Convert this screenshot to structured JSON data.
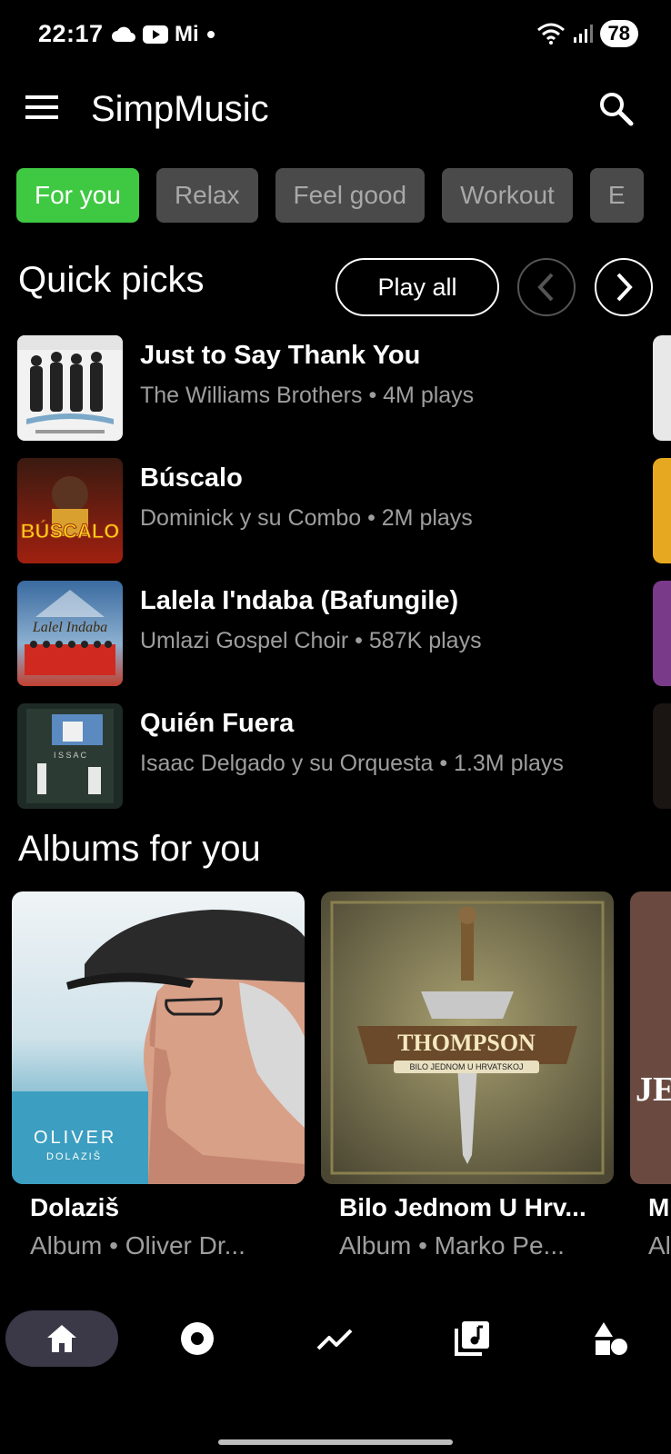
{
  "status_bar": {
    "time": "22:17",
    "carrier": "Mi",
    "battery": "78"
  },
  "app_bar": {
    "title": "SimpMusic",
    "menu_icon": "hamburger-menu-icon",
    "search_icon": "search-icon"
  },
  "chips": [
    {
      "label": "For you",
      "active": true
    },
    {
      "label": "Relax",
      "active": false
    },
    {
      "label": "Feel good",
      "active": false
    },
    {
      "label": "Workout",
      "active": false
    },
    {
      "label": "E",
      "active": false
    }
  ],
  "quick_picks": {
    "title": "Quick picks",
    "play_all_label": "Play all",
    "tracks": [
      {
        "title": "Just to Say Thank You",
        "subtitle": "The Williams Brothers • 4M plays"
      },
      {
        "title": "Búscalo",
        "subtitle": "Dominick y su Combo • 2M plays"
      },
      {
        "title": "Lalela I'ndaba (Bafungile)",
        "subtitle": "Umlazi Gospel Choir • 587K plays"
      },
      {
        "title": "Quién Fuera",
        "subtitle": "Isaac Delgado y su Orquesta • 1.3M plays"
      }
    ]
  },
  "albums": {
    "title": "Albums for you",
    "items": [
      {
        "title": "Dolaziš",
        "subtitle": "Album • Oliver Dr...",
        "art_text_1": "OLIVER",
        "art_text_2": "DOLAZIŠ"
      },
      {
        "title": "Bilo Jednom U Hrv...",
        "subtitle": "Album • Marko Pe...",
        "art_text_1": "THOMPSON",
        "art_text_2": "BILO JEDNOM U HRVATSKOJ"
      },
      {
        "title": "M",
        "subtitle": "Al",
        "art_text_1": "JE"
      }
    ]
  },
  "bottom_nav": [
    {
      "icon": "home-icon",
      "active": true
    },
    {
      "icon": "disc-icon",
      "active": false
    },
    {
      "icon": "trending-icon",
      "active": false
    },
    {
      "icon": "library-music-icon",
      "active": false
    },
    {
      "icon": "categories-icon",
      "active": false
    }
  ],
  "colors": {
    "background": "#000000",
    "accent": "#3fc942",
    "chip_inactive": "#4a4a4a",
    "secondary_text": "#9e9e9e",
    "nav_active_bg": "#3b3848"
  }
}
